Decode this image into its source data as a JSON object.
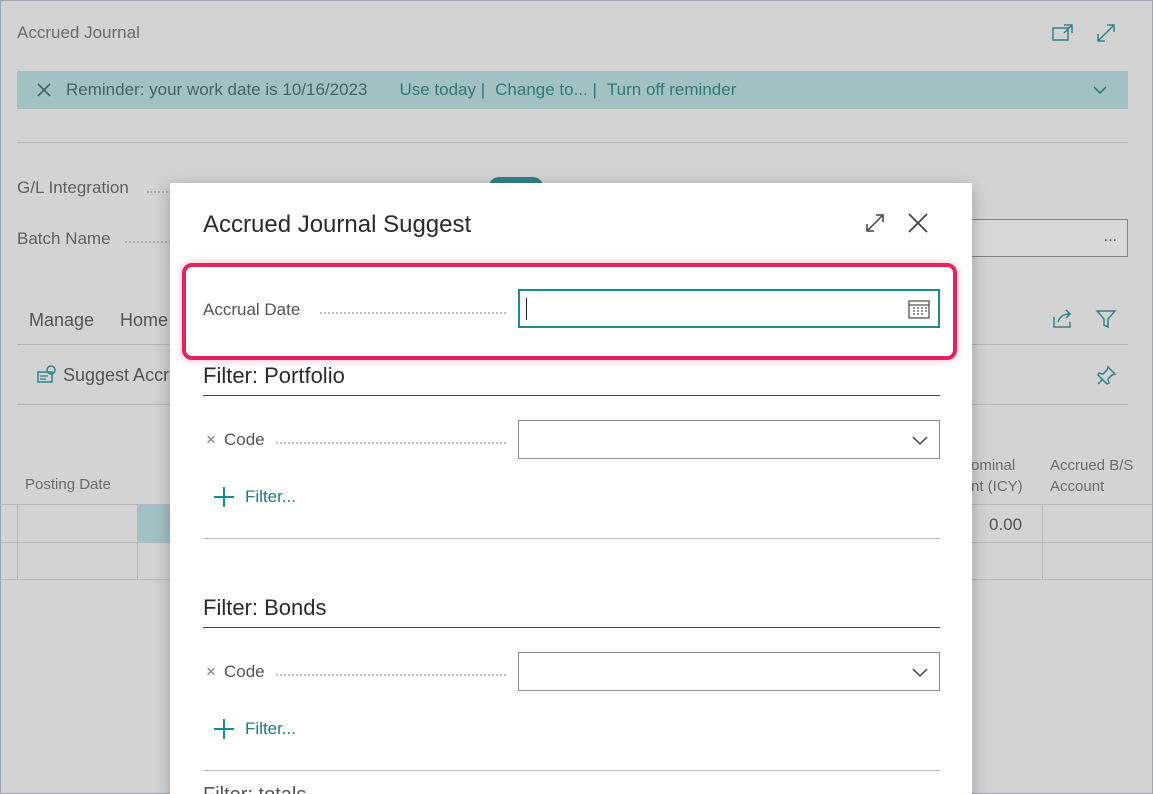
{
  "page": {
    "title": "Accrued Journal"
  },
  "reminder": {
    "message": "Reminder: your work date is 10/16/2023",
    "use_today": "Use today |",
    "change_to": "Change to... |",
    "turn_off": "Turn off reminder"
  },
  "general": {
    "gl_integration_label": "G/L Integration",
    "batch_name_label": "Batch Name",
    "batch_lookup": "..."
  },
  "actions": {
    "tabs": [
      "Manage",
      "Home"
    ],
    "suggest_label": "Suggest Accr"
  },
  "grid": {
    "col_posting_date": "Posting Date",
    "col_nominal_1": "ominal",
    "col_nominal_2": "nt (ICY)",
    "col_accrued_1": "Accrued B/S",
    "col_accrued_2": "Account",
    "row_value": "0.00"
  },
  "dialog": {
    "title": "Accrued Journal Suggest",
    "accrual_date_label": "Accrual Date",
    "accrual_date_value": "",
    "portfolio": {
      "title": "Filter: Portfolio",
      "code_label": "Code",
      "code_value": "",
      "filter_link": "Filter..."
    },
    "bonds": {
      "title": "Filter: Bonds",
      "code_label": "Code",
      "code_value": "",
      "filter_link": "Filter..."
    },
    "next_section_partial": "Filter: totals"
  },
  "colors": {
    "accent": "#1c8a8f",
    "reminder_bg": "#b6e0e2",
    "highlight": "#e3245c"
  }
}
